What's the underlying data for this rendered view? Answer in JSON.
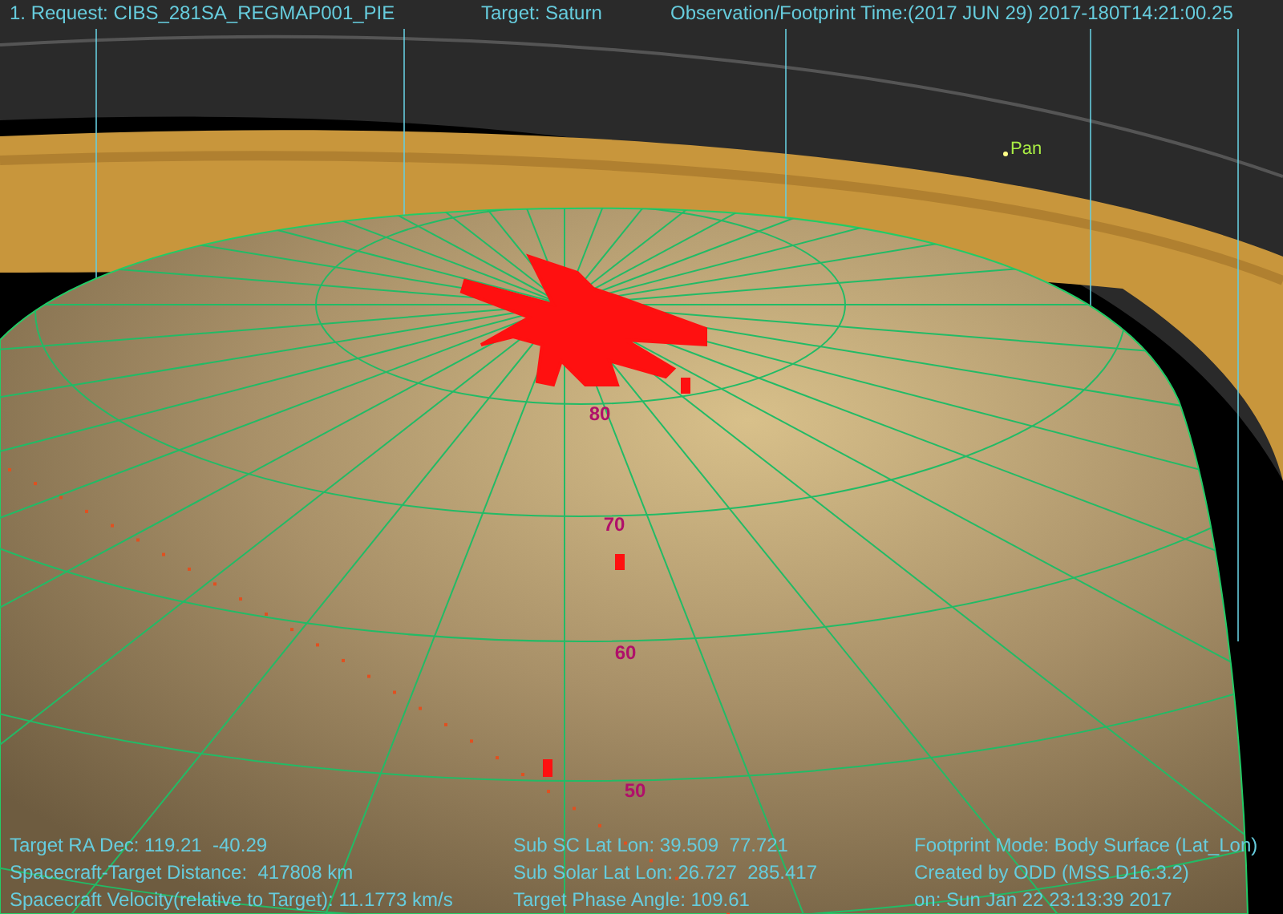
{
  "header": {
    "request": "1. Request: CIBS_281SA_REGMAP001_PIE",
    "target": "Target: Saturn",
    "time": "Observation/Footprint Time:(2017 JUN 29) 2017-180T14:21:00.25"
  },
  "moon_label": "Pan",
  "latitude_labels": [
    "80",
    "70",
    "60",
    "50"
  ],
  "footer": [
    [
      "Target RA Dec: 119.21  -40.29",
      "Spacecraft-Target Distance:  417808 km",
      "Spacecraft Velocity(relative to Target): 11.1773 km/s"
    ],
    [
      "Sub SC Lat Lon: 39.509  77.721",
      "Sub Solar Lat Lon: 26.727  285.417",
      "Target Phase Angle: 109.61"
    ],
    [
      "Footprint Mode: Body Surface (Lat_Lon)",
      "Created by ODD (MSS D16.3.2)",
      "on: Sun Jan 22 23:13:39 2017"
    ]
  ]
}
